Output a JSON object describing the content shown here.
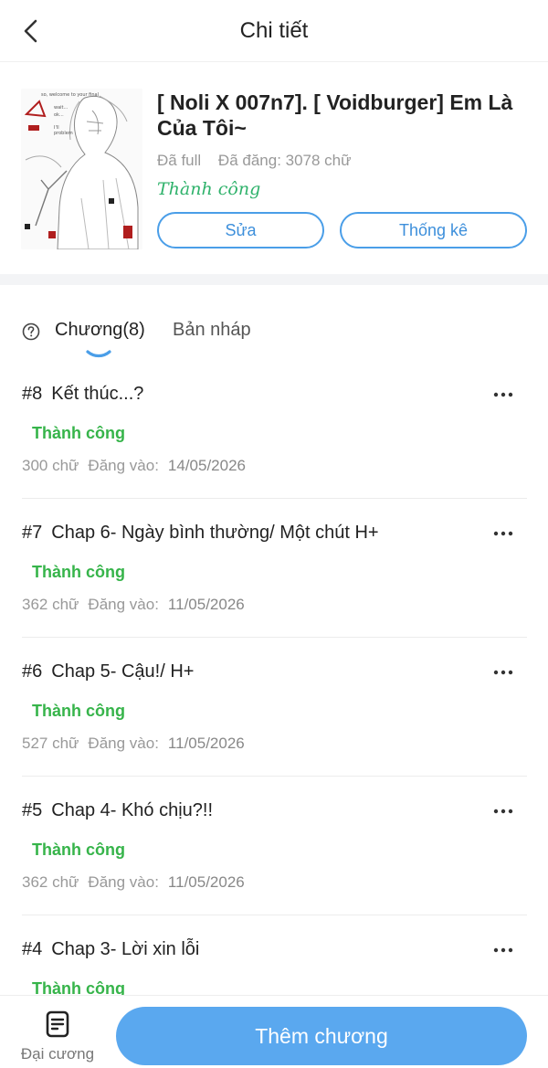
{
  "header": {
    "title": "Chi tiết"
  },
  "book": {
    "title": "[ Noli X 007n7]. [ Voidburger] Em Là Của Tôi~",
    "completion": "Đã full",
    "posted": "Đã đăng: 3078 chữ",
    "status": "Thành công",
    "edit_label": "Sửa",
    "stats_label": "Thống kê",
    "cover_lettering": "so, welcome to your final... wait... ok... I'll problem"
  },
  "tabs": {
    "chapters_label": "Chương(8)",
    "drafts_label": "Bản nháp"
  },
  "chapters": [
    {
      "num": "#8",
      "title": "Kết thúc...?",
      "status": "Thành công",
      "words": "300 chữ",
      "posted_label": "Đăng vào:",
      "date": "14/05/2026"
    },
    {
      "num": "#7",
      "title": "Chap 6- Ngày bình thường/ Một chút H+",
      "status": "Thành công",
      "words": "362 chữ",
      "posted_label": "Đăng vào:",
      "date": "11/05/2026"
    },
    {
      "num": "#6",
      "title": "Chap 5- Cậu!/ H+",
      "status": "Thành công",
      "words": "527 chữ",
      "posted_label": "Đăng vào:",
      "date": "11/05/2026"
    },
    {
      "num": "#5",
      "title": "Chap 4- Khó chịu?!!",
      "status": "Thành công",
      "words": "362 chữ",
      "posted_label": "Đăng vào:",
      "date": "11/05/2026"
    },
    {
      "num": "#4",
      "title": "Chap 3- Lời xin lỗi",
      "status": "Thành công",
      "words": "",
      "posted_label": "",
      "date": ""
    }
  ],
  "bottom": {
    "outline_label": "Đại cương",
    "add_chapter_label": "Thêm chương"
  },
  "colors": {
    "accent": "#5aa8ef",
    "success": "#36b44a",
    "outline_blue": "#4a9ee8"
  },
  "icons": {
    "back": "chevron-left-icon",
    "help": "question-circle-icon",
    "more": "more-horizontal-icon",
    "outline": "document-icon"
  }
}
